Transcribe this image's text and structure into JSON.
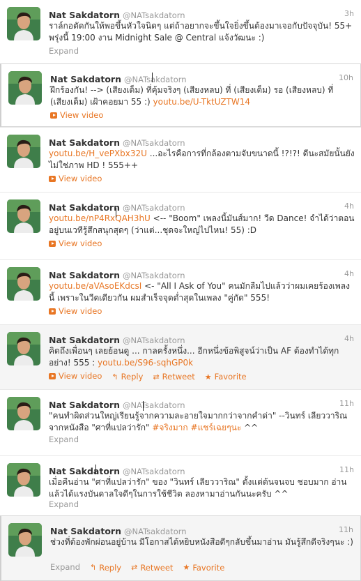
{
  "user": {
    "name": "Nat Sakdatorn",
    "handle": "@NATsakdatorn"
  },
  "colors": {
    "link": "#e87624",
    "muted": "#999999",
    "text": "#333333"
  },
  "icons": {
    "video": "video-play-icon",
    "reply": "reply-arrow-icon",
    "retweet": "retweet-icon",
    "favorite": "star-icon"
  },
  "tweets": [
    {
      "time": "3h",
      "segments": [
        {
          "t": "ราล์กอตัดกันให้พอขึ้นหัวใจนิดๆ แต่ถ้าอยากจะขึ้นใจยิ่งขึ้นต้องมาเจอกับปัจจุบัน! 55+ พรุ่งนี้ 19:00 งาน Midnight Sale @ Central แจ้งวัฒนะ :)"
        }
      ],
      "actions": {
        "expand": "Expand"
      }
    },
    {
      "time": "10h",
      "segments": [
        {
          "t": "ฝึกร้องกัน! --> (เสียงเต็ม) ที่คุ้มจริงๆ (เสียงหลบ) ที่ (เสียงเต็ม) รอ (เสียงหลบ) ที่ (เสียงเต็ม) เฝ้าคอยมา 55 :) "
        },
        {
          "t": "youtu.be/U-TktUZTW14",
          "link": true
        }
      ],
      "actions": {
        "video": "View video"
      }
    },
    {
      "time": "",
      "segments": [
        {
          "t": "youtu.be/H_vePXbx32U",
          "link": true
        },
        {
          "t": " ...อะไรคือการที่กล้องตามจับขนาดนี้ !?!?! ดีนะสมัยนั้นยังไม่ใช่ภาพ HD ! 555++"
        }
      ],
      "actions": {
        "video": "View video"
      }
    },
    {
      "time": "4h",
      "segments": [
        {
          "t": "youtu.be/nP4RxQAH3hU",
          "link": true
        },
        {
          "t": " <-- \"Boom\" เพลงนี้มันส์มาก! วีด Dance! จำได้ว่าตอนอยู่บนเวทีรู้สึกสนุกสุดๆ (ว่าแต่...ชุดจะใหญ่ไปไหน! 55) :D"
        }
      ],
      "actions": {
        "video": "View video"
      }
    },
    {
      "time": "4h",
      "segments": [
        {
          "t": "youtu.be/aVAsoEKdcsI",
          "link": true
        },
        {
          "t": " <- \"All I Ask of You\" คนมักลืมไปแล้วว่าผมเคยร้องเพลงนี้ เพราะในวีดเดียวกัน ผมสำเร็จจุดต่ำสุดในเพลง \"คู่กัด\" 555!"
        }
      ],
      "actions": {
        "video": "View video"
      }
    },
    {
      "time": "4h",
      "segments": [
        {
          "t": "คิดถึงเพื่อนๆ เลยย้อนดู ... กาลครั้งหนึ่ง... อีกหนึ่งข้อพิสูจน์ว่าเป็น AF ต้องทำได้ทุกอย่าง! 555 : "
        },
        {
          "t": "youtu.be/S96-sqhGP0k",
          "link": true
        }
      ],
      "actions": {
        "video": "View video",
        "reply": "Reply",
        "retweet": "Retweet",
        "favorite": "Favorite"
      }
    },
    {
      "time": "11h",
      "segments": [
        {
          "t": "\"คนทำผิดส่วนใหญ่เรียนรู้จากความละอายใจมากกว่าจากคำด่า\" --วินทร์ เลียววาริณ จากหนังสือ \"ศาที่แปลว่ารัก\" "
        },
        {
          "t": "#จริงมาก",
          "tag": true
        },
        {
          "t": " "
        },
        {
          "t": "#แชร์เฉยๆนะ",
          "tag": true
        },
        {
          "t": " ^^"
        }
      ],
      "actions": {
        "expand": "Expand"
      }
    },
    {
      "time": "11h",
      "segments": [
        {
          "t": "เมื่อคืนอ่าน \"ศาที่แปลว่ารัก\" ของ \"วินทร์ เลียววาริณ\" ตั้งแต่ต้นจนจบ ชอบมาก อ่านแล้วได้แรงบันดาลใจดีๆในการใช้ชีวิต ลองหามาอ่านกันนะครับ ^^"
        }
      ],
      "actions": {
        "expand": "Expand"
      }
    },
    {
      "time": "11h",
      "segments": [
        {
          "t": "ช่วงที่ต้องพักผ่อนอยู่บ้าน มีโอกาสได้หยิบหนังสือดีๆกลับขึ้นมาอ่าน มันรู้สึกดีจริงๆนะ :)"
        }
      ],
      "actions": {
        "expand": "Expand",
        "reply": "Reply",
        "retweet": "Retweet",
        "favorite": "Favorite"
      }
    }
  ]
}
